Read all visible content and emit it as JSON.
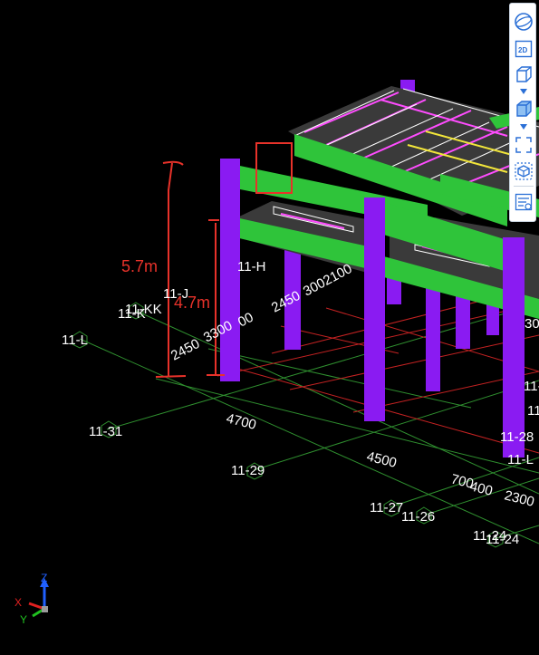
{
  "viewport": {
    "annotations": {
      "height_outer": "5.7m",
      "height_inner": "4.7m"
    },
    "grid_labels": [
      {
        "id": "g1",
        "text": "11-L"
      },
      {
        "id": "g2",
        "text": "11-KK"
      },
      {
        "id": "g3",
        "text": "11-K"
      },
      {
        "id": "g4",
        "text": "11-J"
      },
      {
        "id": "g5",
        "text": "11-H"
      },
      {
        "id": "g6",
        "text": "11-31"
      },
      {
        "id": "g7",
        "text": "11-29"
      },
      {
        "id": "g8",
        "text": "11-27"
      },
      {
        "id": "g9",
        "text": "11-26"
      },
      {
        "id": "g10",
        "text": "11-24"
      },
      {
        "id": "g11",
        "text": "11-24"
      },
      {
        "id": "g12",
        "text": "11-J"
      },
      {
        "id": "g13",
        "text": "11-K"
      },
      {
        "id": "g14",
        "text": "11-28"
      },
      {
        "id": "g15",
        "text": "11-L"
      },
      {
        "id": "g16",
        "text": "30"
      }
    ],
    "dimension_labels": [
      {
        "id": "d1",
        "text": "4700"
      },
      {
        "id": "d2",
        "text": "4500"
      },
      {
        "id": "d3",
        "text": "700"
      },
      {
        "id": "d4",
        "text": "400"
      },
      {
        "id": "d5",
        "text": "2300"
      },
      {
        "id": "d6",
        "text": "2450"
      },
      {
        "id": "d7",
        "text": "3300"
      },
      {
        "id": "d8",
        "text": "2450"
      },
      {
        "id": "d9",
        "text": "3002100"
      },
      {
        "id": "d10",
        "text": "00"
      }
    ],
    "axis_triad": {
      "x": "X",
      "y": "Y",
      "z": "Z"
    }
  },
  "toolbar": {
    "items": [
      {
        "icon": "orbit-icon"
      },
      {
        "icon": "view-2d-icon",
        "label": "2D"
      },
      {
        "icon": "cube-view-icon"
      },
      {
        "icon": "shaded-cube-icon"
      },
      {
        "icon": "fit-view-icon"
      },
      {
        "icon": "isolate-icon"
      },
      {
        "icon": "properties-icon"
      }
    ]
  },
  "colors": {
    "background": "#000000",
    "column": "#8a1bf2",
    "beam": "#2fc43a",
    "slab": "#3c3c3c",
    "annotation": "#e8322a",
    "grid_green": "#2f8f2f",
    "grid_red": "#c42222",
    "slab_line_magenta": "#ff4cff",
    "slab_line_yellow": "#f2e63a"
  }
}
